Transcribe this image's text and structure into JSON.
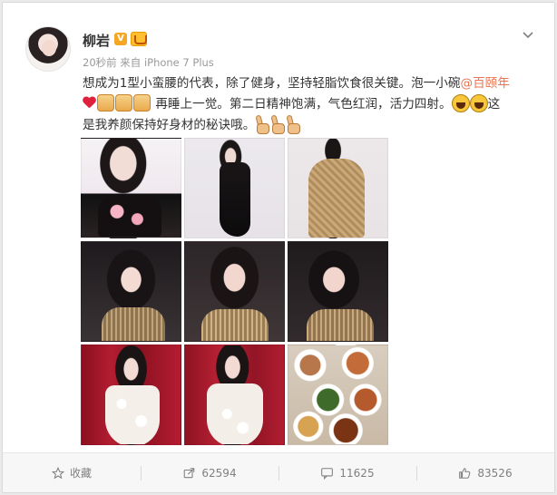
{
  "post": {
    "author": "柳岩",
    "meta": "20秒前 来自 iPhone 7 Plus",
    "text": {
      "line1": "想成为1型小蛮腰的代表，除了健身，坚持轻脂饮食很关键。泡一小碗",
      "mention": "@百颐年",
      "line2": "再睡上一觉。第二日精神饱满，气色红润，活力四射。",
      "line2_tail": "这",
      "line3": "是我养颜保持好身材的秘诀哦。"
    },
    "emoji_icons": [
      "heart-emoji",
      "thumbs-up-emoji",
      "laugh-emoji",
      "peace-emoji"
    ]
  },
  "actions": {
    "favorite": "收藏",
    "repost_count": "62594",
    "comment_count": "11625",
    "like_count": "83526"
  },
  "colors": {
    "accent": "#eb7350",
    "badge": "#f5a623",
    "text": "#333333",
    "muted": "#999999"
  }
}
